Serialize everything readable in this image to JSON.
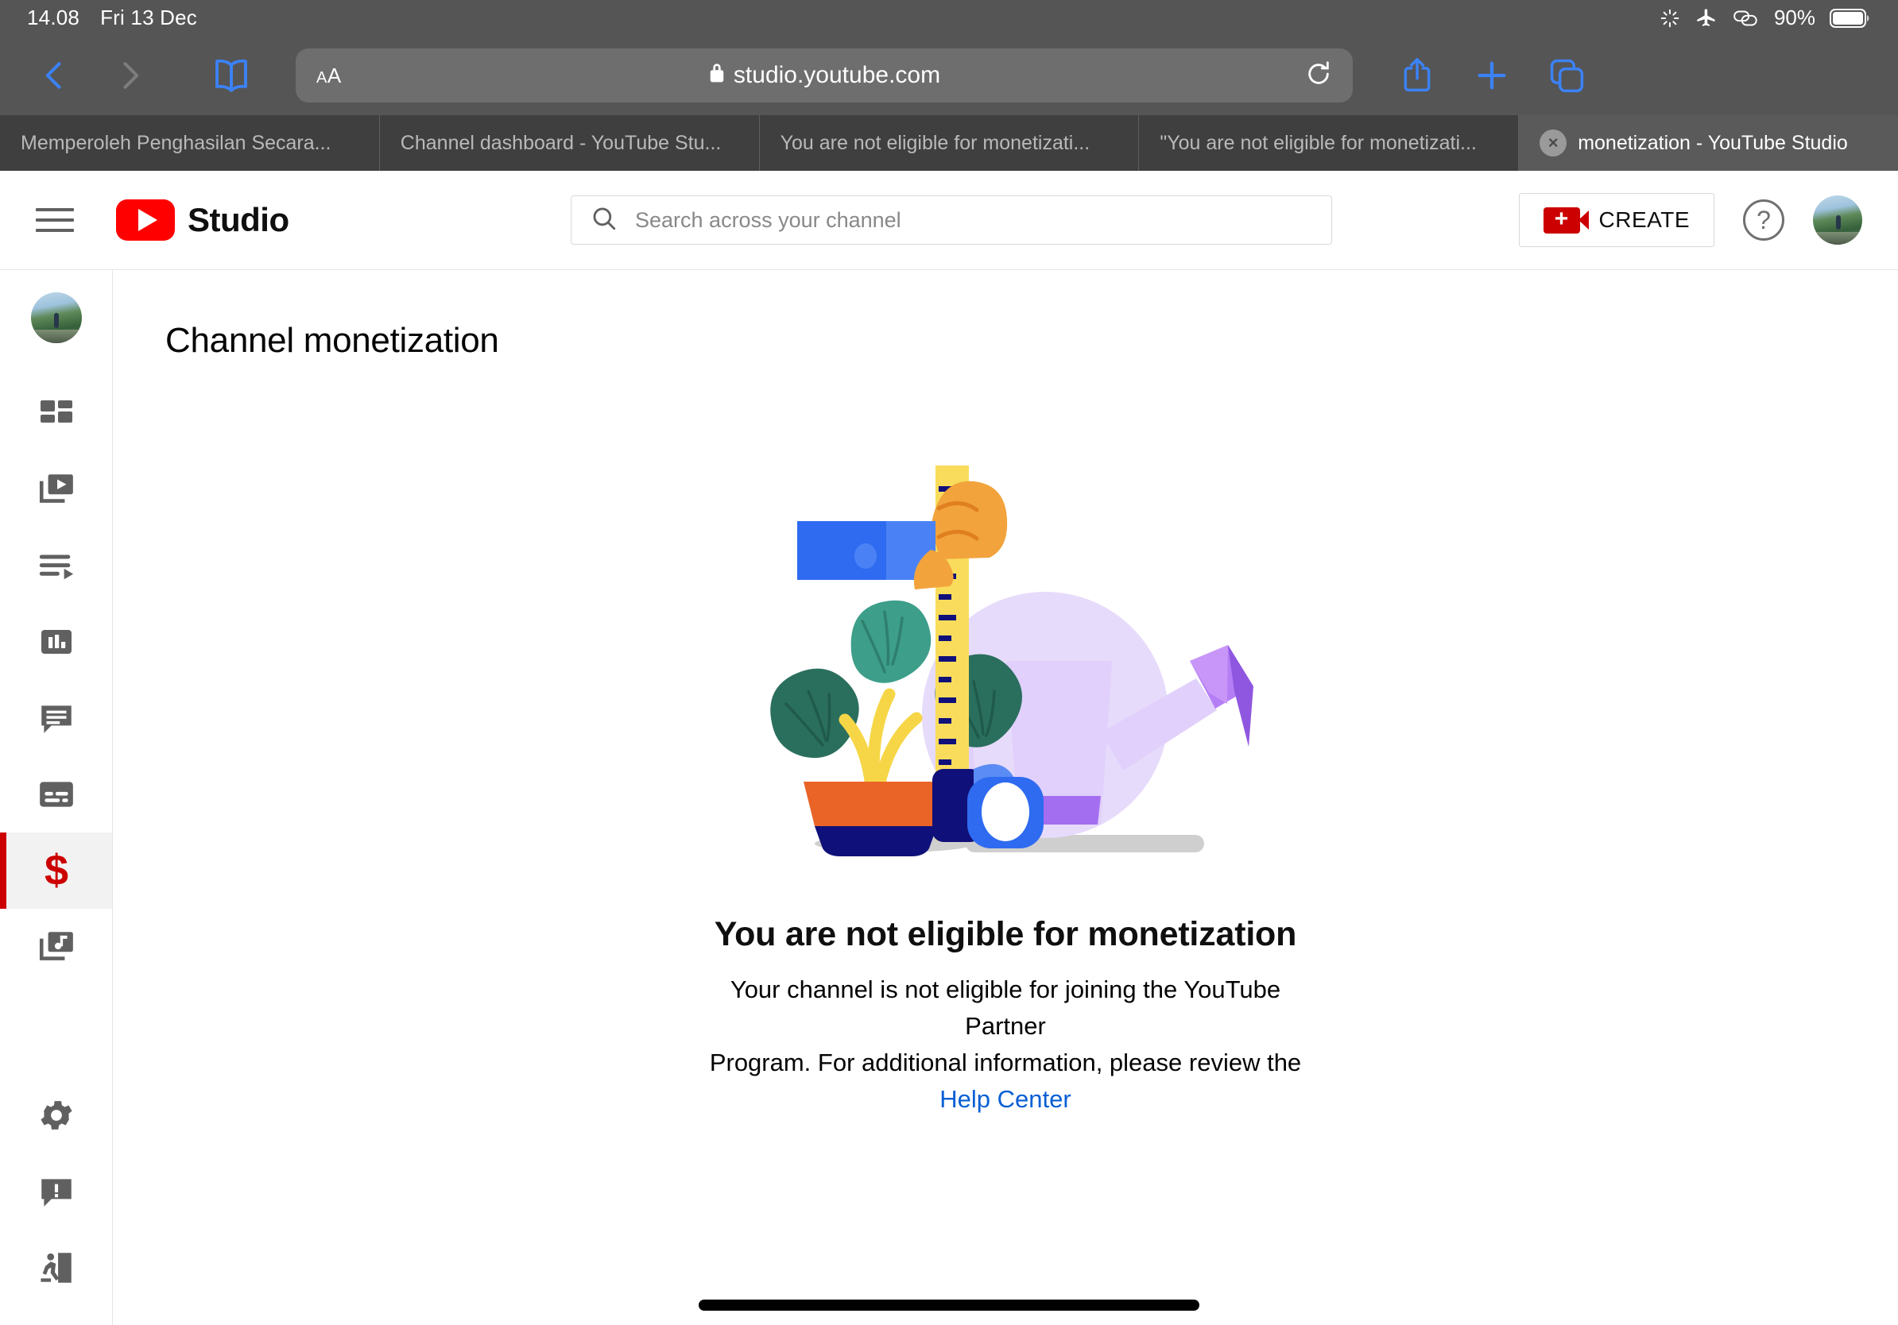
{
  "status_bar": {
    "time": "14.08",
    "date": "Fri 13 Dec",
    "battery_percent": "90%",
    "icons": [
      "spinner-icon",
      "airplane-mode-icon",
      "link-icon",
      "battery-icon"
    ]
  },
  "browser": {
    "back_icon": "chevron-left-icon",
    "forward_icon": "chevron-right-icon",
    "bookmarks_icon": "book-icon",
    "text_size_label_small": "A",
    "text_size_label_large": "A",
    "lock_icon": "lock-icon",
    "url": "studio.youtube.com",
    "reload_icon": "reload-icon",
    "share_icon": "share-icon",
    "new_tab_icon": "plus-icon",
    "tabs_overview_icon": "tabs-icon",
    "tabs": [
      {
        "title": "Memperoleh Penghasilan Secara...",
        "active": false
      },
      {
        "title": "Channel dashboard - YouTube Stu...",
        "active": false
      },
      {
        "title": "You are not eligible for monetizati...",
        "active": false
      },
      {
        "title": "\"You are not eligible for monetizati...",
        "active": false
      },
      {
        "title": "monetization - YouTube Studio",
        "active": true,
        "close_label": "×"
      }
    ]
  },
  "studio": {
    "menu_icon": "hamburger-menu-icon",
    "brand": "Studio",
    "brand_logo_icon": "youtube-logo-icon",
    "search": {
      "icon": "search-icon",
      "placeholder": "Search across your channel",
      "value": ""
    },
    "create_button": {
      "label": "CREATE",
      "icon": "video-camera-plus-icon"
    },
    "help_icon": "help-question-icon",
    "avatar": "channel-avatar"
  },
  "sidebar": {
    "items": [
      {
        "name": "channel-avatar",
        "icon": "avatar-icon",
        "active": false
      },
      {
        "name": "dashboard",
        "icon": "dashboard-grid-icon",
        "active": false
      },
      {
        "name": "content",
        "icon": "video-library-icon",
        "active": false
      },
      {
        "name": "playlists",
        "icon": "playlist-icon",
        "active": false
      },
      {
        "name": "analytics",
        "icon": "bar-chart-icon",
        "active": false
      },
      {
        "name": "comments",
        "icon": "comment-bubble-icon",
        "active": false
      },
      {
        "name": "subtitles",
        "icon": "subtitles-icon",
        "active": false
      },
      {
        "name": "monetization",
        "icon": "dollar-sign-icon",
        "active": true
      },
      {
        "name": "audio-library",
        "icon": "music-library-icon",
        "active": false
      },
      {
        "name": "settings",
        "icon": "gear-icon",
        "active": false
      },
      {
        "name": "send-feedback",
        "icon": "feedback-bubble-icon",
        "active": false
      },
      {
        "name": "exit-studio",
        "icon": "exit-door-icon",
        "active": false
      }
    ],
    "accent_active_color": "#cc0000",
    "active_bg_color": "#f2f2f2"
  },
  "main": {
    "page_title": "Channel monetization",
    "illustration": "plant-watering-can-measuring-tape-illustration",
    "empty_state": {
      "heading": "You are not eligible for monetization",
      "description_line1": "Your channel is not eligible for joining the YouTube Partner",
      "description_line2": "Program. For additional information, please review the",
      "link_label": "Help Center",
      "link_color": "#065fd4"
    }
  },
  "colors": {
    "chrome_bg": "#555555",
    "tabbar_bg": "#3f3f3f",
    "tab_active_bg": "#5a5a5a",
    "safari_accent": "#3b82f6",
    "youtube_red": "#ff0000",
    "text_primary": "#0f0f0f"
  }
}
